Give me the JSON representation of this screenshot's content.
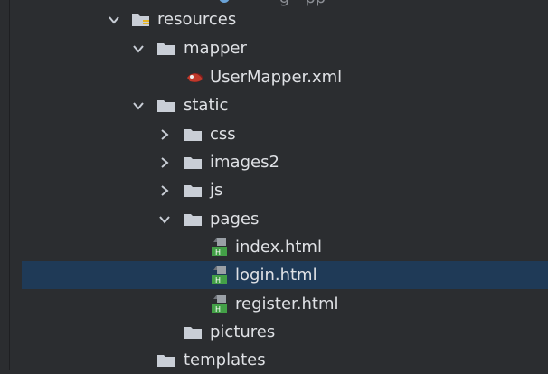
{
  "tree": {
    "items": [
      {
        "label": "resources"
      },
      {
        "label": "mapper"
      },
      {
        "label": "UserMapper.xml"
      },
      {
        "label": "static"
      },
      {
        "label": "css"
      },
      {
        "label": "images2"
      },
      {
        "label": "js"
      },
      {
        "label": "pages"
      },
      {
        "label": "index.html"
      },
      {
        "label": "login.html"
      },
      {
        "label": "register.html"
      },
      {
        "label": "pictures"
      },
      {
        "label": "templates"
      }
    ],
    "selected_item": "login.html"
  },
  "colors": {
    "background": "#2b2d30",
    "selection": "#1f3a57",
    "text": "#dfe1e5",
    "folder": "#c9ced6",
    "html_icon": "#43a047"
  }
}
